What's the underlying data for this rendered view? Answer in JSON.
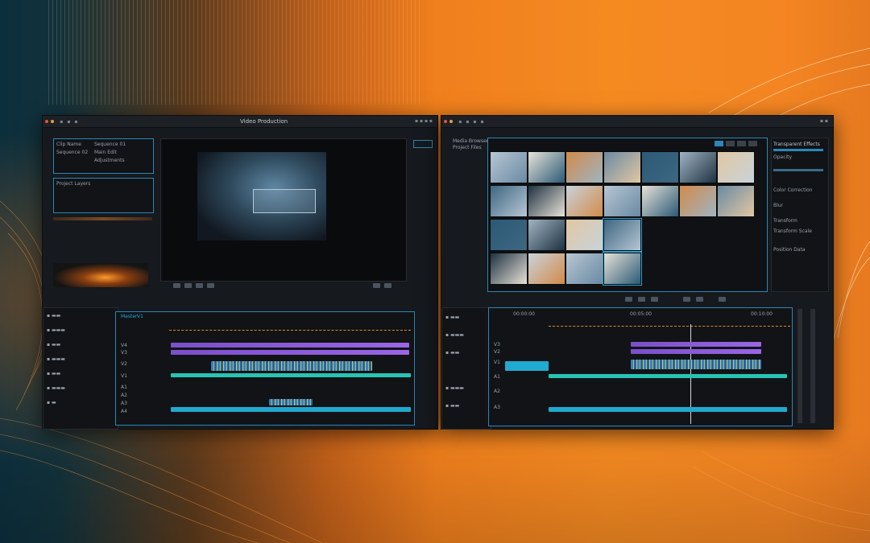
{
  "window_left": {
    "title": "Video Production",
    "media_panel": {
      "rows": [
        "Clip Name",
        "Sequence 01",
        "Sequence 02",
        "Main Edit",
        "Adjustments"
      ],
      "note": "Project Layers"
    },
    "monitor": {
      "controls": [
        "step-back",
        "play",
        "step-forward",
        "mark-in",
        "mark-out"
      ]
    },
    "timeline": {
      "tabs": [
        "Master",
        "V1"
      ],
      "track_labels": [
        "V4",
        "V3",
        "V2",
        "V1",
        "A1",
        "A2",
        "A3",
        "A4"
      ]
    }
  },
  "window_right": {
    "media_browser": {
      "header": "Media Browser",
      "folder": "Project Files"
    },
    "properties_panel": {
      "title": "Transparent Effects",
      "items": [
        "Opacity",
        "Color Correction",
        "Blur",
        "Transform",
        "Transform Scale",
        "Position Data"
      ]
    },
    "timeline": {
      "markers": [
        "00:00:00",
        "00:05:00",
        "00:10:00"
      ],
      "track_labels": [
        "V3",
        "V2",
        "V1",
        "A1",
        "A2",
        "A3"
      ]
    }
  }
}
